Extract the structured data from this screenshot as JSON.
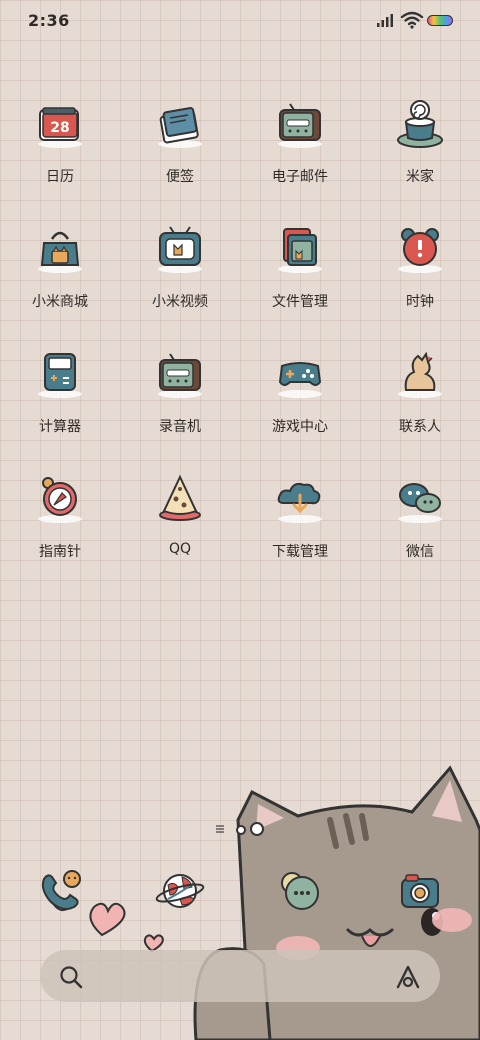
{
  "status_bar": {
    "time": "2:36"
  },
  "apps": [
    [
      {
        "label": "日历",
        "icon": "calendar-icon",
        "date": "28"
      },
      {
        "label": "便签",
        "icon": "notes-icon"
      },
      {
        "label": "电子邮件",
        "icon": "email-icon"
      },
      {
        "label": "米家",
        "icon": "mijia-icon"
      }
    ],
    [
      {
        "label": "小米商城",
        "icon": "mi-store-icon"
      },
      {
        "label": "小米视频",
        "icon": "mi-video-icon"
      },
      {
        "label": "文件管理",
        "icon": "file-manager-icon"
      },
      {
        "label": "时钟",
        "icon": "clock-icon"
      }
    ],
    [
      {
        "label": "计算器",
        "icon": "calculator-icon"
      },
      {
        "label": "录音机",
        "icon": "recorder-icon"
      },
      {
        "label": "游戏中心",
        "icon": "game-center-icon"
      },
      {
        "label": "联系人",
        "icon": "contacts-icon"
      }
    ],
    [
      {
        "label": "指南针",
        "icon": "compass-icon"
      },
      {
        "label": "QQ",
        "icon": "qq-icon"
      },
      {
        "label": "下载管理",
        "icon": "download-manager-icon"
      },
      {
        "label": "微信",
        "icon": "wechat-icon"
      }
    ]
  ],
  "dock": [
    {
      "icon": "phone-icon"
    },
    {
      "icon": "browser-icon"
    },
    {
      "icon": "messages-icon"
    },
    {
      "icon": "camera-icon"
    }
  ]
}
